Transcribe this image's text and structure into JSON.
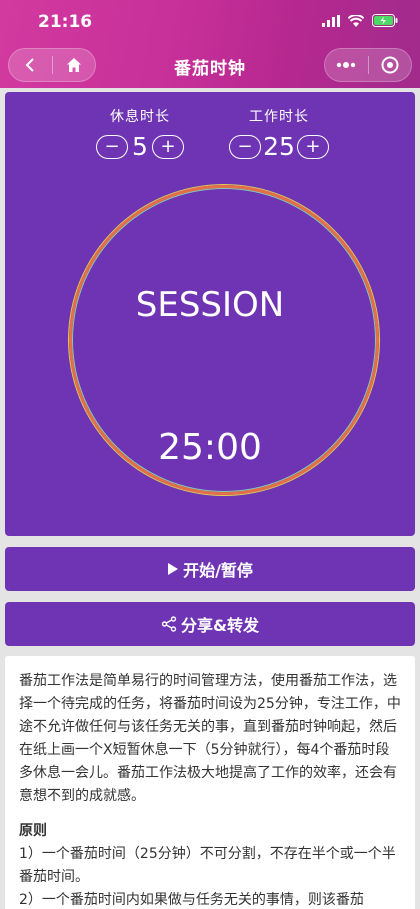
{
  "status": {
    "time": "21:16"
  },
  "nav": {
    "title": "番茄时钟"
  },
  "settings": {
    "break": {
      "label": "休息时长",
      "value": "5",
      "minus": "−",
      "plus": "+"
    },
    "work": {
      "label": "工作时长",
      "value": "25",
      "minus": "−",
      "plus": "+"
    }
  },
  "timer": {
    "label": "SESSION",
    "time": "25:00"
  },
  "buttons": {
    "start": "开始/暂停",
    "share": "分享&转发"
  },
  "description": {
    "intro": "番茄工作法是简单易行的时间管理方法，使用番茄工作法，选择一个待完成的任务，将番茄时间设为25分钟，专注工作，中途不允许做任何与该任务无关的事，直到番茄时钟响起，然后在纸上画一个X短暂休息一下（5分钟就行），每4个番茄时段多休息一会儿。番茄工作法极大地提高了工作的效率，还会有意想不到的成就感。",
    "principles_title": "原则",
    "principle_1": "1）一个番茄时间（25分钟）不可分割，不存在半个或一个半番茄时间。",
    "principle_2": "2）一个番茄时间内如果做与任务无关的事情，则该番茄"
  },
  "colors": {
    "header": "#c8309a",
    "card": "#6f34b4",
    "ring": "#e46e4a"
  }
}
